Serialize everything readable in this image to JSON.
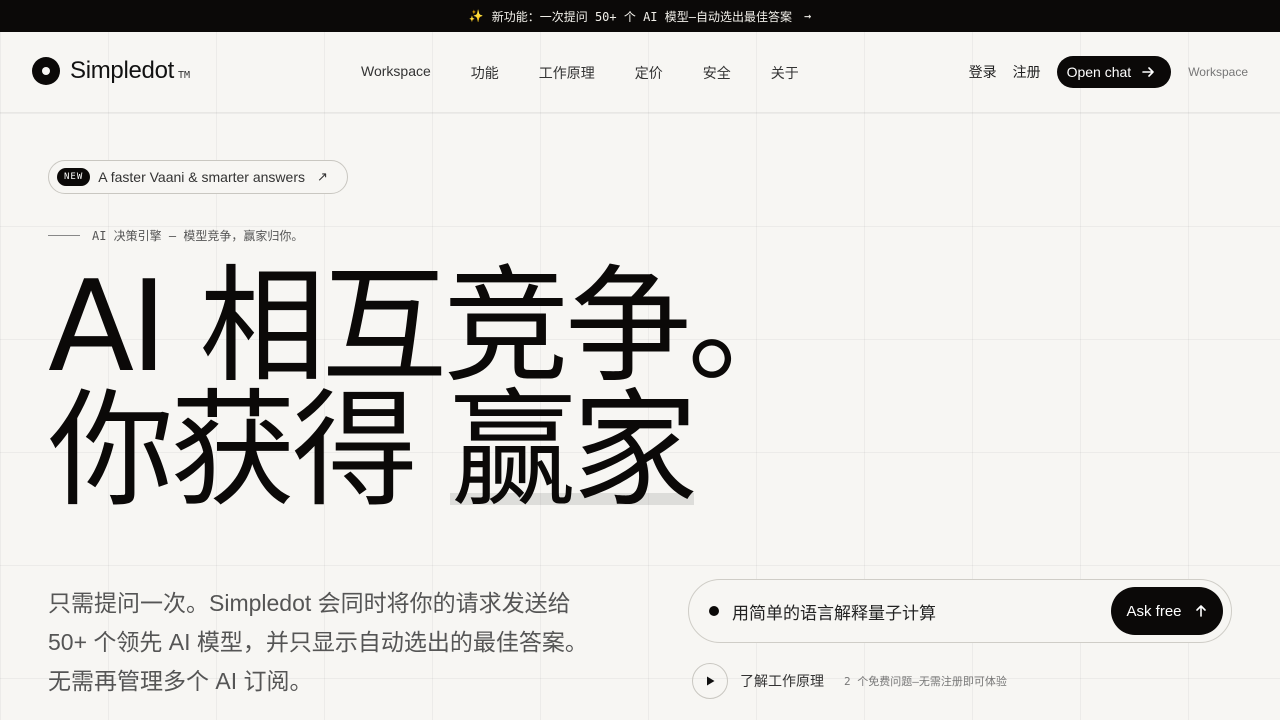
{
  "announcement": {
    "icon": "sparkle-icon",
    "text": "新功能：一次提问 50+ 个 AI 模型—自动选出最佳答案",
    "arrow": "→"
  },
  "brand": {
    "name": "Simpledot",
    "tm": "TM"
  },
  "nav": {
    "items": [
      "Workspace",
      "功能",
      "工作原理",
      "定价",
      "安全",
      "关于"
    ]
  },
  "auth": {
    "login": "登录",
    "register": "注册",
    "open_chat": "Open chat",
    "workspace": "Workspace"
  },
  "hero": {
    "badge": "NEW",
    "pill_text": "A faster Vaani & smarter answers",
    "pill_arrow": "↗",
    "kicker": "AI 决策引擎 — 模型竞争，赢家归你。",
    "headline_line1": "AI 相互竞争。",
    "headline_line2_prefix": "你获得 ",
    "headline_line2_highlight": "赢家",
    "subtext": "只需提问一次。Simpledot 会同时将你的请求发送给 50+ 个领先 AI 模型，并只显示自动选出的最佳答案。无需再管理多个 AI 订阅。"
  },
  "ask": {
    "prompt": "用简单的语言解释量子计算",
    "button": "Ask free",
    "button_icon": "arrow-up-icon"
  },
  "learn": {
    "label": "了解工作原理",
    "free_note": "2 个免费问题—无需注册即可体验"
  }
}
